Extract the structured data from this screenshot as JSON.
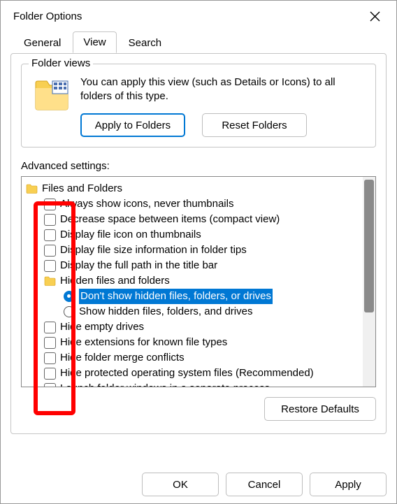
{
  "title": "Folder Options",
  "tabs": {
    "general": "General",
    "view": "View",
    "search": "Search"
  },
  "folderViews": {
    "groupTitle": "Folder views",
    "text": "You can apply this view (such as Details or Icons) to all folders of this type.",
    "applyBtn": "Apply to Folders",
    "resetBtn": "Reset Folders"
  },
  "advancedLabel": "Advanced settings:",
  "tree": {
    "root": "Files and Folders",
    "items": [
      "Always show icons, never thumbnails",
      "Decrease space between items (compact view)",
      "Display file icon on thumbnails",
      "Display file size information in folder tips",
      "Display the full path in the title bar"
    ],
    "hiddenGroup": "Hidden files and folders",
    "radioDontShow": "Don't show hidden files, folders, or drives",
    "radioShow": "Show hidden files, folders, and drives",
    "items2": [
      "Hide empty drives",
      "Hide extensions for known file types",
      "Hide folder merge conflicts",
      "Hide protected operating system files (Recommended)",
      "Launch folder windows in a separate process"
    ]
  },
  "restoreBtn": "Restore Defaults",
  "bottom": {
    "ok": "OK",
    "cancel": "Cancel",
    "apply": "Apply"
  }
}
